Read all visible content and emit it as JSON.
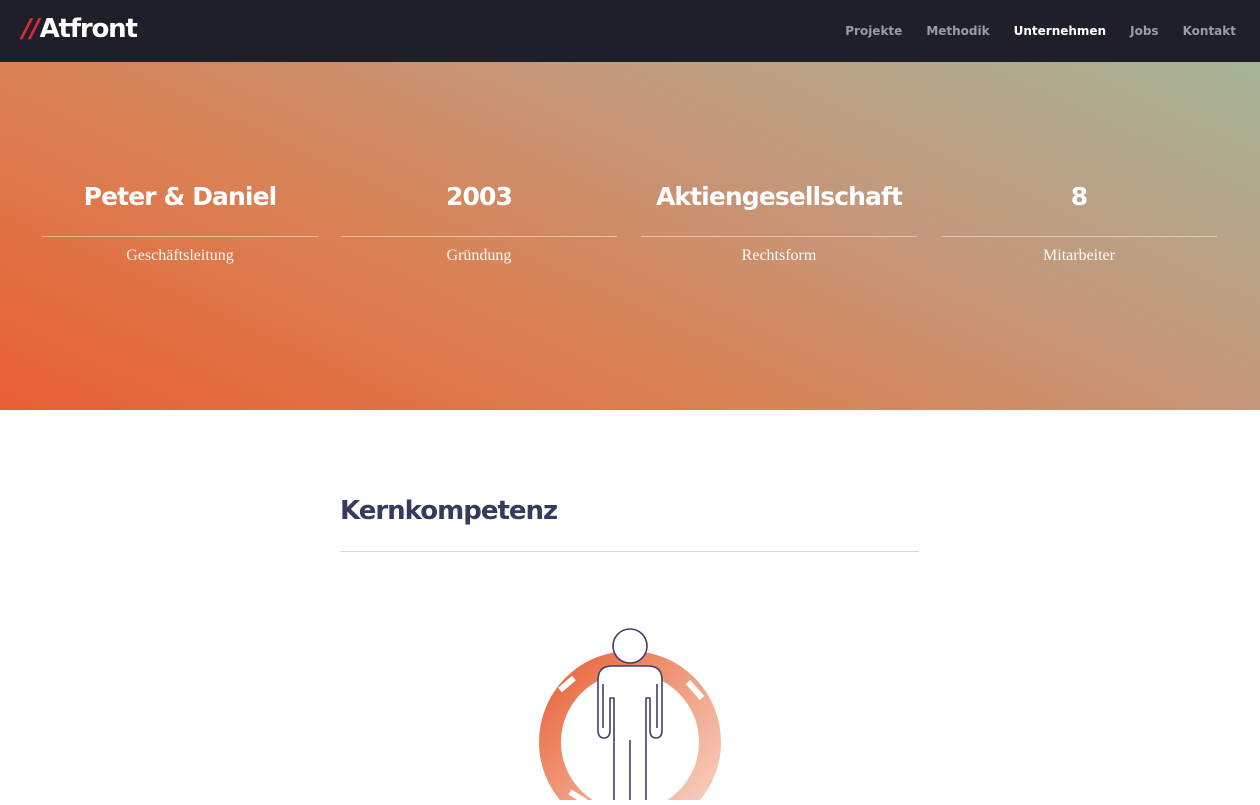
{
  "logo": {
    "slashes": "//",
    "name": "Atfront"
  },
  "nav": {
    "items": [
      {
        "label": "Projekte",
        "active": false
      },
      {
        "label": "Methodik",
        "active": false
      },
      {
        "label": "Unternehmen",
        "active": true
      },
      {
        "label": "Jobs",
        "active": false
      },
      {
        "label": "Kontakt",
        "active": false
      }
    ]
  },
  "stats": [
    {
      "value": "Peter & Daniel",
      "label": "Geschäftsleitung"
    },
    {
      "value": "2003",
      "label": "Gründung"
    },
    {
      "value": "Aktiengesellschaft",
      "label": "Rechtsform"
    },
    {
      "value": "8",
      "label": "Mitarbeiter"
    }
  ],
  "section": {
    "title": "Kernkompetenz"
  },
  "icons": {
    "core_competence": "person-circle-icon"
  },
  "colors": {
    "topbar": "#1d2029",
    "logo_accent": "#e0283a",
    "hero_start": "#e85f33",
    "hero_end": "#a6b597",
    "heading": "#353a5e",
    "figure_ring": "#ee7a52"
  }
}
